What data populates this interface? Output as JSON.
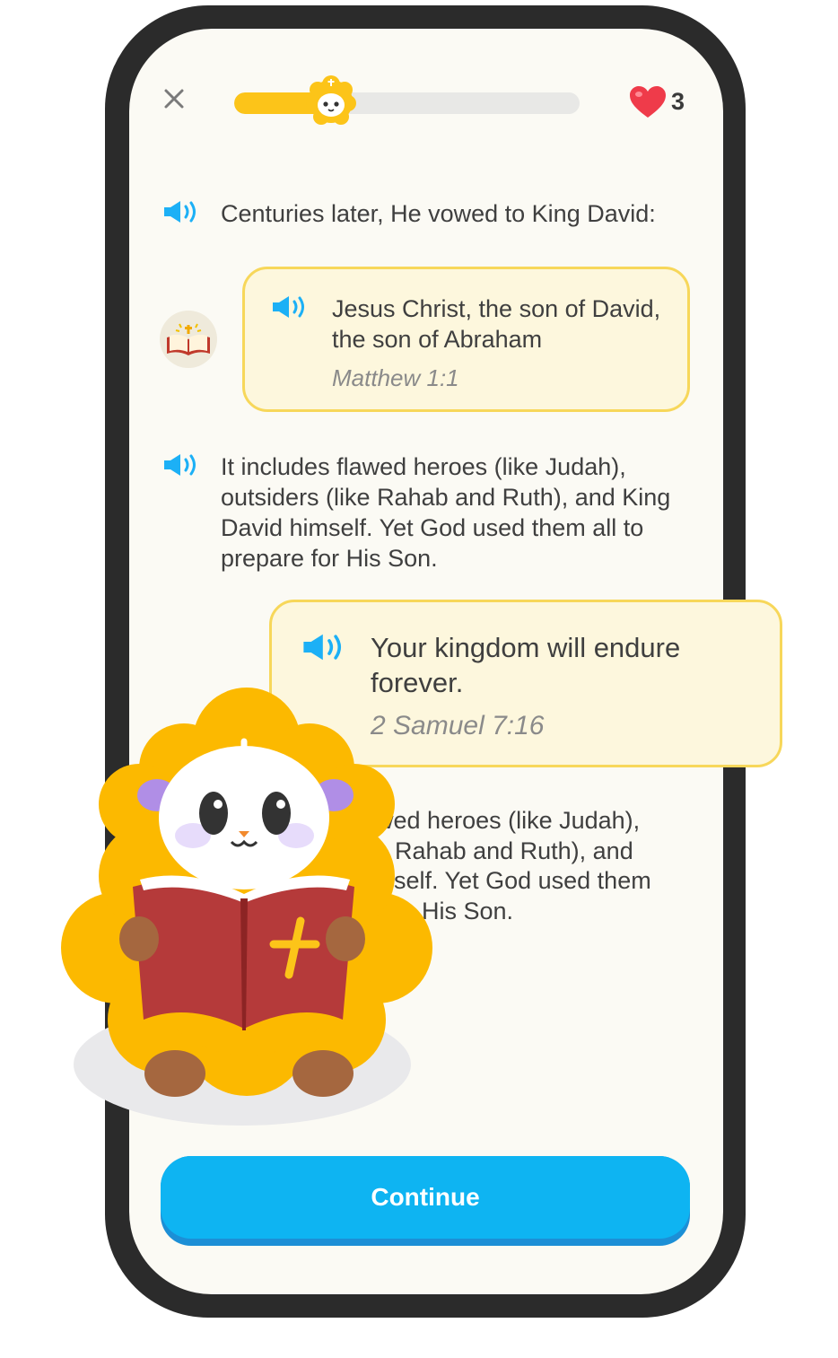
{
  "header": {
    "close_icon": "close-icon",
    "progress_fraction": 0.28,
    "hearts": "3"
  },
  "lines": [
    {
      "text": "Centuries later, He vowed to King David:"
    },
    {
      "text": "It includes flawed heroes (like Judah), outsiders (like Rahab and Ruth), and King David himself. Yet God used them all to prepare for His Son."
    }
  ],
  "verse_card_1": {
    "text": "Jesus Christ, the son of David, the son of Abraham",
    "reference": "Matthew 1:1"
  },
  "verse_card_2": {
    "text": "Your kingdom will endure forever.",
    "reference": "2 Samuel 7:16"
  },
  "obscured_text": {
    "line1": "awed heroes (like Judah),",
    "line2": "ke Rahab and Ruth), and",
    "line3": "nself. Yet God used them",
    "line4": "His Son."
  },
  "continue_label": "Continue",
  "colors": {
    "accent_blue": "#0eb4f2",
    "progress_yellow": "#fcc419",
    "card_border": "#f7d75a",
    "heart_red": "#ef3b4a"
  }
}
